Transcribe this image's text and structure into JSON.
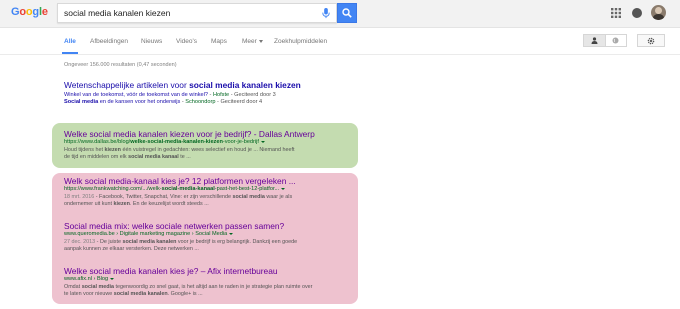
{
  "header": {
    "logo_letters": [
      "G",
      "o",
      "o",
      "g",
      "l",
      "e"
    ],
    "query": "social media kanalen kiezen"
  },
  "tabs": {
    "all": "Alle",
    "images": "Afbeeldingen",
    "news": "Nieuws",
    "videos": "Video's",
    "maps": "Maps",
    "more": "Meer",
    "tools": "Zoekhulpmiddelen"
  },
  "stats": "Ongeveer 156.000 resultaten (0,47 seconden)",
  "scholar": {
    "title_pre": "Wetenschappelijke artikelen voor ",
    "title_bold": "social media kanalen kiezen",
    "items": [
      {
        "title": "Winkel van de toekomst, vóór de toekomst van de winkel?",
        "source": "Hofste",
        "cite": "Geciteerd door 3"
      },
      {
        "title_bold": "Social media",
        "title_rest": " en de kansen voor het onderwijs",
        "source": "Schoondorp",
        "cite": "Geciteerd door 4"
      }
    ]
  },
  "results": [
    {
      "title": "Welke social media kanalen kiezen voor je bedrijf? - Dallas Antwerp",
      "url_pre": "https://www.dallas.be/blog/",
      "url_bold": "welke-social-media-kanalen-kiezen",
      "url_post": "-voor-je-bedrijf",
      "snippet_1a": "Houd tijdens het ",
      "snippet_1b": "kiezen",
      "snippet_1c": " één vuistregel in gedachten: wees selectief en houd je ... Niemand heeft",
      "snippet_2a": "de tijd en middelen om elk ",
      "snippet_2b": "social media kanaal",
      "snippet_2c": " te ..."
    },
    {
      "title": "Welk social media-kanaal kies je? 12 platformen vergeleken ...",
      "url_pre": "https://www.frankwatching.com/.../welk-",
      "url_bold": "social-media-kanaal",
      "url_post": "-past-het-best-12-platfor...",
      "date": "18 mrt. 2016",
      "snippet_1a": " - Facebook, Twitter, Snapchat, Vine: er zijn verschillende ",
      "snippet_1b": "social media",
      "snippet_1c": " waar je als",
      "snippet_2a": "ondernemer uit kunt ",
      "snippet_2b": "kiezen",
      "snippet_2c": ". En de keuzelijst wordt steeds ..."
    },
    {
      "title": "Social media mix: welke sociale netwerken passen samen?",
      "url_pre": "www.queromedia.be › Digitale marketing magazine › ",
      "url_bold": "Social Media",
      "url_post": "",
      "date": "27 dec. 2013",
      "snippet_1a": " - De juiste ",
      "snippet_1b": "social media kanalen",
      "snippet_1c": " voor je bedrijf is erg belangrijk. Dankzij een goede",
      "snippet_2a": "aanpak kunnen ze elkaar versterken. Deze netwerken ...",
      "snippet_2b": "",
      "snippet_2c": ""
    },
    {
      "title": "Welke social media kanalen kies je? – Afix internetbureau",
      "url_pre": "www.afix.nl › Blog",
      "url_bold": "",
      "url_post": "",
      "snippet_1a": "Omdat ",
      "snippet_1b": "social media",
      "snippet_1c": " tegenwoordig zo snel gaat, is het altijd aan te raden in je strategie plan ruimte over",
      "snippet_2a": "te laten voor nieuwe ",
      "snippet_2b": "social media kanalen",
      "snippet_2c": ". Google+ is ..."
    }
  ],
  "colors": {
    "link": "#1a0dab",
    "visited": "#660099",
    "url_green": "#006621",
    "accent_blue": "#4285f4",
    "highlight_green": "#c4dcb0",
    "highlight_pink": "#eec2cf"
  }
}
